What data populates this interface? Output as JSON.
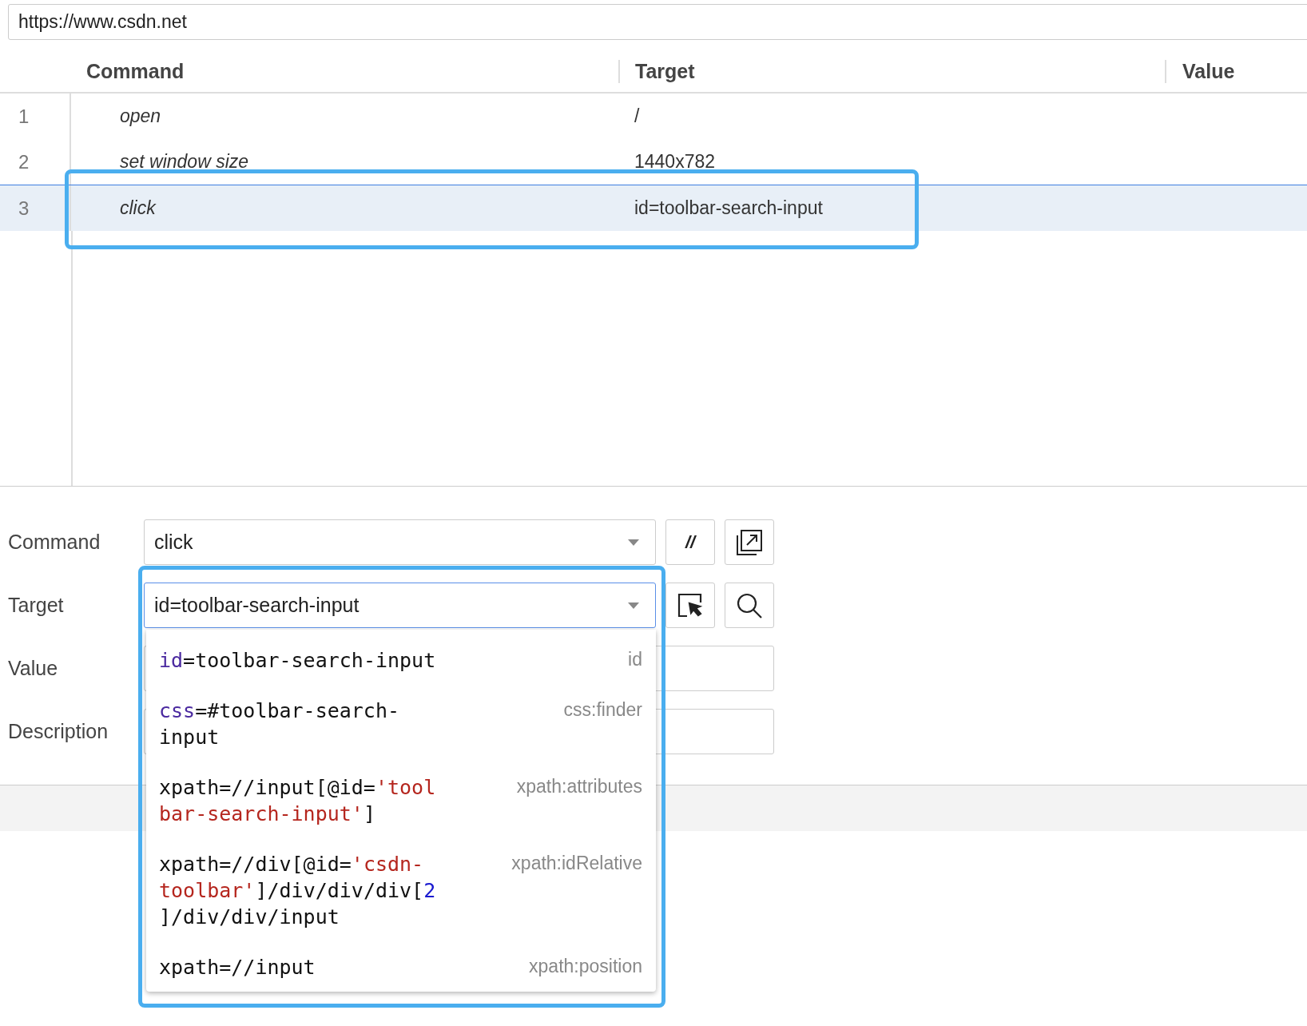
{
  "url_bar": {
    "value": "https://www.csdn.net"
  },
  "table": {
    "columns": [
      "Command",
      "Target",
      "Value"
    ],
    "rows": [
      {
        "index": "1",
        "command": "open",
        "target": "/",
        "value": "",
        "selected": false
      },
      {
        "index": "2",
        "command": "set window size",
        "target": "1440x782",
        "value": "",
        "selected": false
      },
      {
        "index": "3",
        "command": "click",
        "target": "id=toolbar-search-input",
        "value": "",
        "selected": true
      }
    ]
  },
  "editor": {
    "command_label": "Command",
    "command_value": "click",
    "comment_button": "//",
    "target_label": "Target",
    "target_value": "id=toolbar-search-input",
    "value_label": "Value",
    "description_label": "Description"
  },
  "target_suggestions": [
    {
      "locator": [
        {
          "kind": "keyword",
          "text": "id"
        },
        {
          "kind": "plain",
          "text": "=toolbar-search-input"
        }
      ],
      "strategy": "id"
    },
    {
      "locator": [
        {
          "kind": "keyword",
          "text": "css"
        },
        {
          "kind": "plain",
          "text": "=#toolbar-search-input"
        }
      ],
      "strategy": "css:finder"
    },
    {
      "locator": [
        {
          "kind": "plain",
          "text": "xpath=//input[@id="
        },
        {
          "kind": "string",
          "text": "'toolbar-search-input'"
        },
        {
          "kind": "plain",
          "text": "]"
        }
      ],
      "strategy": "xpath:attributes"
    },
    {
      "locator": [
        {
          "kind": "plain",
          "text": "xpath=//div[@id="
        },
        {
          "kind": "string",
          "text": "'csdn-toolbar'"
        },
        {
          "kind": "plain",
          "text": "]/div/div/div["
        },
        {
          "kind": "number",
          "text": "2"
        },
        {
          "kind": "plain",
          "text": "]/div/div/input"
        }
      ],
      "strategy": "xpath:idRelative"
    },
    {
      "locator": [
        {
          "kind": "plain",
          "text": "xpath=//input"
        }
      ],
      "strategy": "xpath:position"
    }
  ]
}
